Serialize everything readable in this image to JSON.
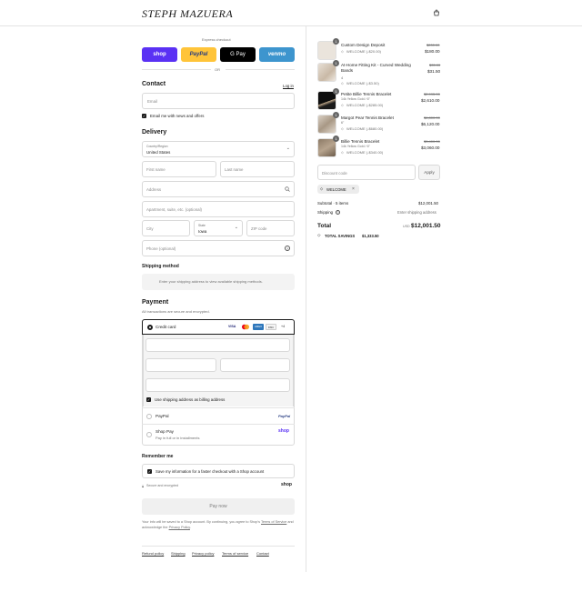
{
  "header": {
    "logo": "STEPH MAZUERA",
    "cart_icon": "bag-icon"
  },
  "express": {
    "label": "Express checkout",
    "buttons": [
      {
        "label": "shop",
        "color": "#5a31f4"
      },
      {
        "label": "PayPal",
        "color": "#ffc439"
      },
      {
        "label": "G Pay",
        "color": "#000000"
      },
      {
        "label": "venmo",
        "color": "#3d95ce"
      }
    ],
    "or": "OR"
  },
  "contact": {
    "title": "Contact",
    "login": "Log in",
    "email_placeholder": "Email",
    "news_label": "Email me with news and offers"
  },
  "delivery": {
    "title": "Delivery",
    "country_label": "Country/Region",
    "country_value": "United States",
    "first_name": "First name",
    "last_name": "Last name",
    "address": "Address",
    "apartment": "Apartment, suite, etc. (optional)",
    "city": "City",
    "state_label": "State",
    "state_value": "Iowa",
    "zip": "ZIP code",
    "phone": "Phone (optional)"
  },
  "shipping": {
    "title": "Shipping method",
    "note": "Enter your shipping address to view available shipping methods."
  },
  "payment": {
    "title": "Payment",
    "subtitle": "All transactions are secure and encrypted.",
    "credit_card": "Credit card",
    "card_badges": [
      "VISA",
      "MC",
      "AMEX",
      "DISC",
      "+4"
    ],
    "billing_label": "Use shipping address as billing address",
    "paypal": "PayPal",
    "paypal_logo": "PayPal",
    "shoppay": "Shop Pay",
    "shoppay_sub": "Pay in full or in installments",
    "shoppay_logo": "shop"
  },
  "remember": {
    "title": "Remember me",
    "save_label": "Save my information for a faster checkout with a Shop account",
    "secure": "Secure and encrypted",
    "shop_logo": "shop"
  },
  "pay_now": "Pay now",
  "legal": {
    "line1": "Your info will be saved to a Shop account. By continuing, you agree to Shop's",
    "terms": "Terms of Service",
    "and": "and acknowledge the",
    "privacy": "Privacy Policy",
    "period": "."
  },
  "footer_links": [
    "Refund policy",
    "Shipping",
    "Privacy policy",
    "Terms of service",
    "Contact"
  ],
  "order": {
    "items": [
      {
        "name": "Custom Design Deposit",
        "variant": "",
        "discount": "WELCOME (-$20.00)",
        "old": "$200.00",
        "price": "$180.00",
        "qty": "1"
      },
      {
        "name": "At-Home Fitting Kit - Curved Wedding Bands",
        "variant": "4",
        "discount": "WELCOME (-$3.50)",
        "old": "$35.00",
        "price": "$31.50",
        "qty": "1"
      },
      {
        "name": "Petite Billie Tennis Bracelet",
        "variant": "14k Yellow Gold / 6\"",
        "discount": "WELCOME (-$285.00)",
        "old": "$2,995.00",
        "price": "$2,610.00",
        "qty": "1"
      },
      {
        "name": "Margot Pear Tennis Bracelet",
        "variant": "6\"",
        "discount": "WELCOME (-$680.00)",
        "old": "$6,800.00",
        "price": "$6,120.00",
        "qty": "1"
      },
      {
        "name": "Billie Tennis Bracelet",
        "variant": "14k Yellow Gold / 6\"",
        "discount": "WELCOME (-$340.00)",
        "old": "$3,400.00",
        "price": "$3,060.00",
        "qty": "1"
      }
    ],
    "discount_placeholder": "Discount code",
    "apply": "Apply",
    "code_tag": "WELCOME",
    "subtotal_label": "Subtotal · 5 items",
    "subtotal": "$12,001.50",
    "shipping_label": "Shipping",
    "shipping_value": "Enter shipping address",
    "total_label": "Total",
    "currency": "USD",
    "total": "$12,001.50",
    "savings_label": "TOTAL SAVINGS",
    "savings": "$1,333.50"
  }
}
